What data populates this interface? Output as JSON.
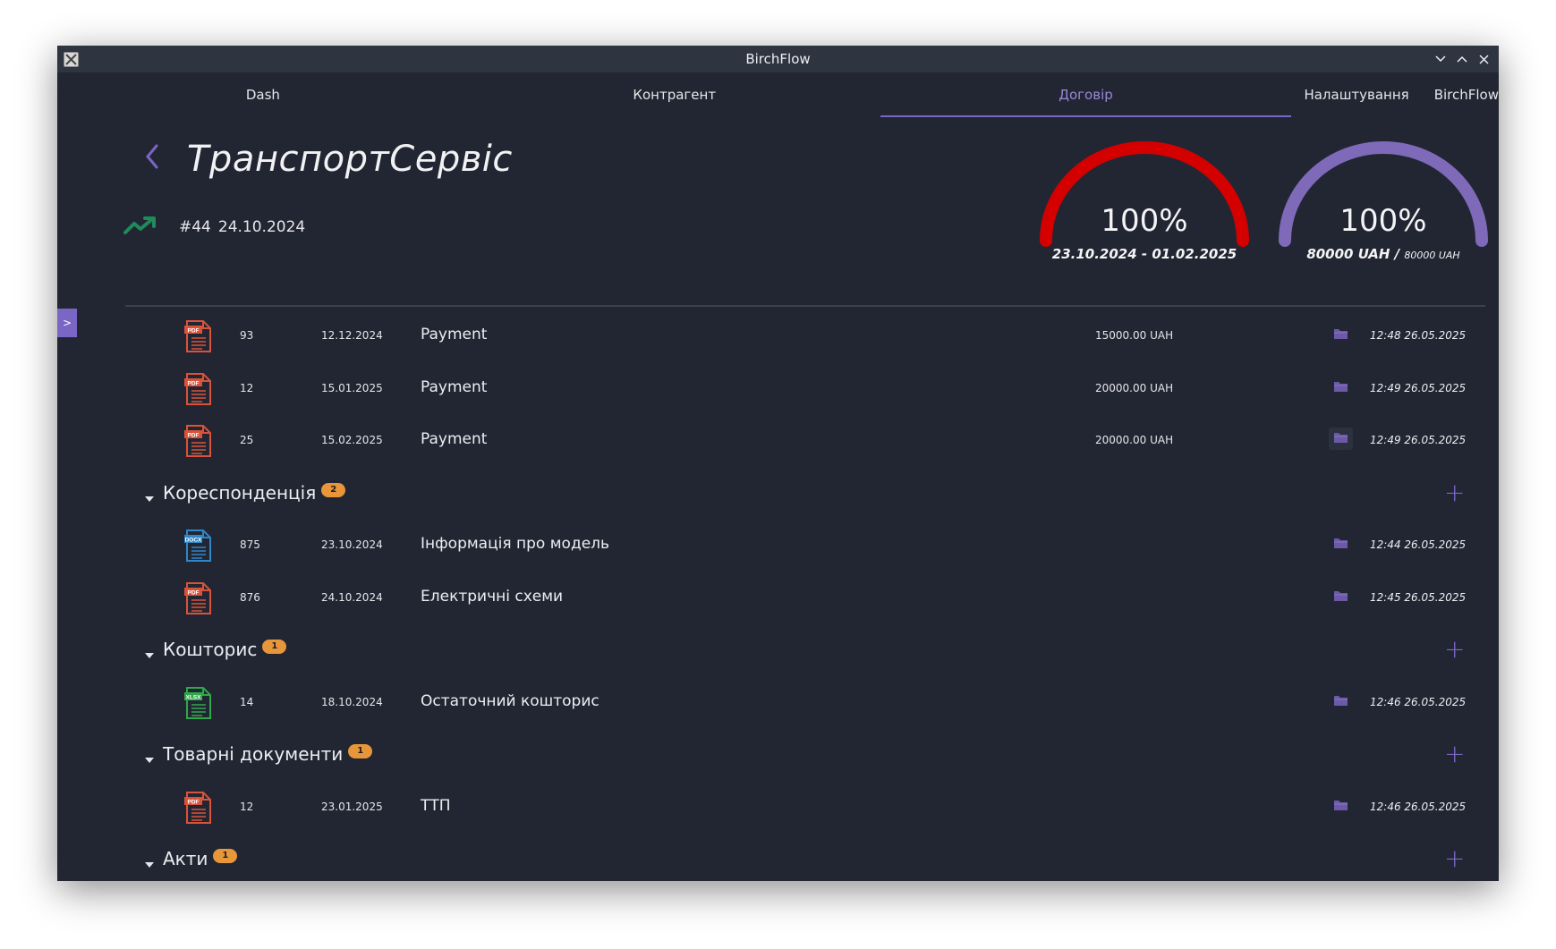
{
  "window": {
    "title": "BirchFlow"
  },
  "nav": {
    "tabs": [
      {
        "label": "Dash",
        "active": false
      },
      {
        "label": "Контрагент",
        "active": false
      },
      {
        "label": "Договір",
        "active": true
      }
    ],
    "right": [
      "Налаштування",
      "BirchFlow"
    ]
  },
  "header": {
    "title": "ТранспортСервіс",
    "number": "#44",
    "date": "24.10.2024",
    "trend_icon": "trending-up-icon",
    "gauge_time": {
      "percent": "100%",
      "value": 1.0,
      "color": "#d40000",
      "range": "23.10.2024 - 01.02.2025"
    },
    "gauge_money": {
      "percent": "100%",
      "value": 1.0,
      "color": "#7e6ab8",
      "paid": "80000 UAH /",
      "total": "80000 UAH"
    }
  },
  "sidebar_toggle": ">",
  "payments": [
    {
      "type": "pdf",
      "num": "93",
      "date": "12.12.2024",
      "name": "Payment",
      "amount": "15000.00 UAH",
      "ts": "12:48 26.05.2025"
    },
    {
      "type": "pdf",
      "num": "12",
      "date": "15.01.2025",
      "name": "Payment",
      "amount": "20000.00 UAH",
      "ts": "12:49 26.05.2025"
    },
    {
      "type": "pdf",
      "num": "25",
      "date": "15.02.2025",
      "name": "Payment",
      "amount": "20000.00 UAH",
      "ts": "12:49 26.05.2025"
    }
  ],
  "sections": [
    {
      "title": "Кореспонденція",
      "count": "2",
      "items": [
        {
          "type": "docx",
          "num": "875",
          "date": "23.10.2024",
          "name": "Інформація про модель",
          "ts": "12:44 26.05.2025"
        },
        {
          "type": "pdf",
          "num": "876",
          "date": "24.10.2024",
          "name": "Електричні схеми",
          "ts": "12:45 26.05.2025"
        }
      ]
    },
    {
      "title": "Кошторис",
      "count": "1",
      "items": [
        {
          "type": "xlsx",
          "num": "14",
          "date": "18.10.2024",
          "name": "Остаточний кошторис",
          "ts": "12:46 26.05.2025"
        }
      ]
    },
    {
      "title": "Товарні документи",
      "count": "1",
      "items": [
        {
          "type": "pdf",
          "num": "12",
          "date": "23.01.2025",
          "name": "ТТП",
          "ts": "12:46 26.05.2025"
        }
      ]
    },
    {
      "title": "Акти",
      "count": "1",
      "items": []
    }
  ],
  "colors": {
    "accent": "#7a66c4",
    "badge": "#e8963a",
    "pdf": "#d9533a",
    "docx": "#2f86c8",
    "xlsx": "#2fa84a",
    "background": "#222632"
  }
}
